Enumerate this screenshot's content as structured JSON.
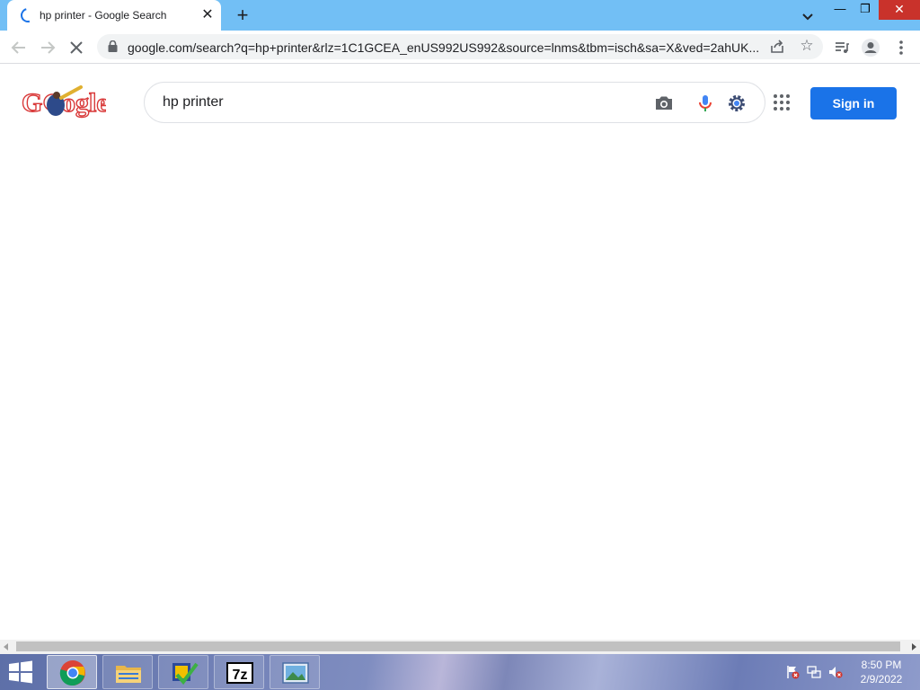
{
  "browser": {
    "tab": {
      "title": "hp printer - Google Search"
    },
    "address_bar": {
      "url": "google.com/search?q=hp+printer&rlz=1C1GCEA_enUS992US992&source=lnms&tbm=isch&sa=X&ved=2ahUK..."
    }
  },
  "page": {
    "search_query": "hp printer",
    "sign_in_label": "Sign in",
    "accent_color": "#1a73e8"
  },
  "taskbar": {
    "apps": [
      "chrome-icon",
      "file-explorer-icon",
      "task-app-icon",
      "7zip-icon",
      "photo-viewer-icon"
    ],
    "seven_zip_label": "7z",
    "clock": {
      "time": "8:50 PM",
      "date": "2/9/2022"
    }
  }
}
